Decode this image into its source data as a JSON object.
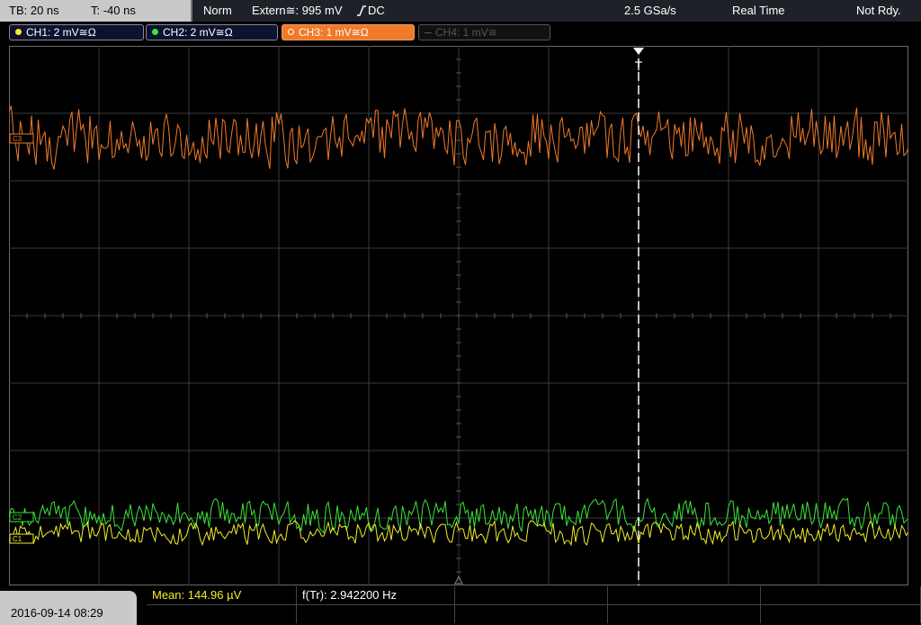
{
  "status_bar": {
    "timebase": "TB: 20 ns",
    "trigger_time": "T: -40 ns",
    "mode": "Norm",
    "trigger_info": "Extern≅: 995 mV",
    "trigger_coupling": "DC",
    "sample_rate": "2.5 GSa/s",
    "acq_mode": "Real Time",
    "state": "Not Rdy."
  },
  "channels": [
    {
      "label": "CH1: 2 mV≅Ω",
      "color": "#f2ee2a",
      "active": true
    },
    {
      "label": "CH2: 2 mV≅Ω",
      "color": "#39e639",
      "active": true
    },
    {
      "label": "CH3: 1 mV≅Ω",
      "color": "#f07a2a",
      "active": true,
      "selected": true
    },
    {
      "label": "CH4: 1 mV≅",
      "color": "#555555",
      "active": false
    }
  ],
  "markers": {
    "ch3": "C3",
    "ch2": "C2",
    "ch1": "C1",
    "trigger": "T"
  },
  "measurements": {
    "mean": "Mean: 144.96 µV",
    "freq": "f(Tr): 2.942200 Hz"
  },
  "datetime": "2016-09-14 08:29"
}
